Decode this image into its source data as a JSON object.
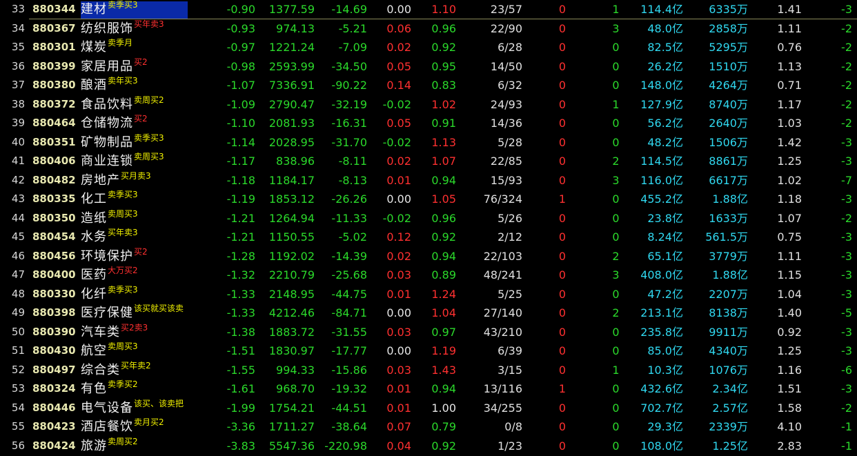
{
  "colors": {
    "background": "#000000",
    "up": "#ff3030",
    "down": "#2bd92b",
    "flat": "#e6e6e6",
    "volume": "#30d8f0",
    "tag": "#f0f000",
    "selection": "#0a2aa8"
  },
  "rows": [
    {
      "seq": "33",
      "code": "880344",
      "name": "建材",
      "tag": "卖季买3",
      "tag_color": "yellow",
      "chg": "-0.90",
      "price": "1377.59",
      "amt": "-14.69",
      "spd": "0.00",
      "spd_color": "white",
      "ratio": "1.10",
      "ratio_color": "red",
      "ud": "23/57",
      "lim": "0",
      "lim_color": "red",
      "cnt": "1",
      "cnt_color": "green",
      "vol": "114.4亿",
      "vol2": "6335万",
      "mult": "1.41",
      "last": "-3",
      "selected": true
    },
    {
      "seq": "34",
      "code": "880367",
      "name": "纺织服饰",
      "tag": "买年卖3",
      "tag_color": "red",
      "chg": "-0.93",
      "price": "974.13",
      "amt": "-5.21",
      "spd": "0.06",
      "spd_color": "red",
      "ratio": "0.96",
      "ratio_color": "green",
      "ud": "22/90",
      "lim": "0",
      "lim_color": "red",
      "cnt": "3",
      "cnt_color": "green",
      "vol": "48.0亿",
      "vol2": "2858万",
      "mult": "1.11",
      "last": "-2"
    },
    {
      "seq": "35",
      "code": "880301",
      "name": "煤炭",
      "tag": "卖季月",
      "tag_color": "yellow",
      "chg": "-0.97",
      "price": "1221.24",
      "amt": "-7.09",
      "spd": "0.02",
      "spd_color": "red",
      "ratio": "0.92",
      "ratio_color": "green",
      "ud": "6/28",
      "lim": "0",
      "lim_color": "red",
      "cnt": "0",
      "cnt_color": "green",
      "vol": "82.5亿",
      "vol2": "5295万",
      "mult": "0.76",
      "last": "-2"
    },
    {
      "seq": "36",
      "code": "880399",
      "name": "家居用品",
      "tag": "买2",
      "tag_color": "red",
      "chg": "-0.98",
      "price": "2593.99",
      "amt": "-34.50",
      "spd": "0.05",
      "spd_color": "red",
      "ratio": "0.95",
      "ratio_color": "green",
      "ud": "14/50",
      "lim": "0",
      "lim_color": "red",
      "cnt": "0",
      "cnt_color": "green",
      "vol": "26.2亿",
      "vol2": "1510万",
      "mult": "1.13",
      "last": "-2"
    },
    {
      "seq": "37",
      "code": "880380",
      "name": "酿酒",
      "tag": "卖年买3",
      "tag_color": "yellow",
      "chg": "-1.07",
      "price": "7336.91",
      "amt": "-90.22",
      "spd": "0.14",
      "spd_color": "red",
      "ratio": "0.83",
      "ratio_color": "green",
      "ud": "6/32",
      "lim": "0",
      "lim_color": "red",
      "cnt": "0",
      "cnt_color": "green",
      "vol": "148.0亿",
      "vol2": "4264万",
      "mult": "0.71",
      "last": "-2"
    },
    {
      "seq": "38",
      "code": "880372",
      "name": "食品饮料",
      "tag": "卖周买2",
      "tag_color": "yellow",
      "chg": "-1.09",
      "price": "2790.47",
      "amt": "-32.19",
      "spd": "-0.02",
      "spd_color": "green",
      "ratio": "1.02",
      "ratio_color": "red",
      "ud": "24/93",
      "lim": "0",
      "lim_color": "red",
      "cnt": "1",
      "cnt_color": "green",
      "vol": "127.9亿",
      "vol2": "8740万",
      "mult": "1.17",
      "last": "-2"
    },
    {
      "seq": "39",
      "code": "880464",
      "name": "仓储物流",
      "tag": "买2",
      "tag_color": "red",
      "chg": "-1.10",
      "price": "2081.93",
      "amt": "-16.31",
      "spd": "0.05",
      "spd_color": "red",
      "ratio": "0.91",
      "ratio_color": "green",
      "ud": "14/36",
      "lim": "0",
      "lim_color": "red",
      "cnt": "0",
      "cnt_color": "green",
      "vol": "56.2亿",
      "vol2": "2640万",
      "mult": "1.03",
      "last": "-2"
    },
    {
      "seq": "40",
      "code": "880351",
      "name": "矿物制品",
      "tag": "卖季买3",
      "tag_color": "yellow",
      "chg": "-1.14",
      "price": "2028.95",
      "amt": "-31.70",
      "spd": "-0.02",
      "spd_color": "green",
      "ratio": "1.13",
      "ratio_color": "red",
      "ud": "5/28",
      "lim": "0",
      "lim_color": "red",
      "cnt": "0",
      "cnt_color": "green",
      "vol": "48.2亿",
      "vol2": "1506万",
      "mult": "1.42",
      "last": "-3"
    },
    {
      "seq": "41",
      "code": "880406",
      "name": "商业连锁",
      "tag": "卖周买3",
      "tag_color": "yellow",
      "chg": "-1.17",
      "price": "838.96",
      "amt": "-8.11",
      "spd": "0.02",
      "spd_color": "red",
      "ratio": "1.07",
      "ratio_color": "red",
      "ud": "22/85",
      "lim": "0",
      "lim_color": "red",
      "cnt": "2",
      "cnt_color": "green",
      "vol": "114.5亿",
      "vol2": "8861万",
      "mult": "1.25",
      "last": "-3"
    },
    {
      "seq": "42",
      "code": "880482",
      "name": "房地产",
      "tag": "买月卖3",
      "tag_color": "yellow",
      "chg": "-1.18",
      "price": "1184.17",
      "amt": "-8.13",
      "spd": "0.01",
      "spd_color": "red",
      "ratio": "0.94",
      "ratio_color": "green",
      "ud": "15/93",
      "lim": "0",
      "lim_color": "red",
      "cnt": "3",
      "cnt_color": "green",
      "vol": "116.0亿",
      "vol2": "6617万",
      "mult": "1.02",
      "last": "-7"
    },
    {
      "seq": "43",
      "code": "880335",
      "name": "化工",
      "tag": "卖季买3",
      "tag_color": "yellow",
      "chg": "-1.19",
      "price": "1853.12",
      "amt": "-26.26",
      "spd": "0.00",
      "spd_color": "white",
      "ratio": "1.05",
      "ratio_color": "red",
      "ud": "76/324",
      "lim": "1",
      "lim_color": "red",
      "cnt": "0",
      "cnt_color": "green",
      "vol": "455.2亿",
      "vol2": "1.88亿",
      "mult": "1.18",
      "last": "-3"
    },
    {
      "seq": "44",
      "code": "880350",
      "name": "造纸",
      "tag": "卖周买3",
      "tag_color": "yellow",
      "chg": "-1.21",
      "price": "1264.94",
      "amt": "-11.33",
      "spd": "-0.02",
      "spd_color": "green",
      "ratio": "0.96",
      "ratio_color": "green",
      "ud": "5/26",
      "lim": "0",
      "lim_color": "red",
      "cnt": "0",
      "cnt_color": "green",
      "vol": "23.8亿",
      "vol2": "1633万",
      "mult": "1.07",
      "last": "-2"
    },
    {
      "seq": "45",
      "code": "880454",
      "name": "水务",
      "tag": "买年卖3",
      "tag_color": "yellow",
      "chg": "-1.21",
      "price": "1150.55",
      "amt": "-5.02",
      "spd": "0.12",
      "spd_color": "red",
      "ratio": "0.92",
      "ratio_color": "green",
      "ud": "2/12",
      "lim": "0",
      "lim_color": "red",
      "cnt": "0",
      "cnt_color": "green",
      "vol": "8.24亿",
      "vol2": "561.5万",
      "mult": "0.75",
      "last": "-3"
    },
    {
      "seq": "46",
      "code": "880456",
      "name": "环境保护",
      "tag": "买2",
      "tag_color": "red",
      "chg": "-1.28",
      "price": "1192.02",
      "amt": "-14.39",
      "spd": "0.02",
      "spd_color": "red",
      "ratio": "0.94",
      "ratio_color": "green",
      "ud": "22/103",
      "lim": "0",
      "lim_color": "red",
      "cnt": "2",
      "cnt_color": "green",
      "vol": "65.1亿",
      "vol2": "3779万",
      "mult": "1.11",
      "last": "-3"
    },
    {
      "seq": "47",
      "code": "880400",
      "name": "医药",
      "tag": "大万买2",
      "tag_color": "red",
      "chg": "-1.32",
      "price": "2210.79",
      "amt": "-25.68",
      "spd": "0.03",
      "spd_color": "red",
      "ratio": "0.89",
      "ratio_color": "green",
      "ud": "48/241",
      "lim": "0",
      "lim_color": "red",
      "cnt": "3",
      "cnt_color": "green",
      "vol": "408.0亿",
      "vol2": "1.88亿",
      "mult": "1.15",
      "last": "-3"
    },
    {
      "seq": "48",
      "code": "880330",
      "name": "化纤",
      "tag": "卖季买3",
      "tag_color": "yellow",
      "chg": "-1.33",
      "price": "2148.95",
      "amt": "-44.75",
      "spd": "0.01",
      "spd_color": "red",
      "ratio": "1.24",
      "ratio_color": "red",
      "ud": "5/25",
      "lim": "0",
      "lim_color": "red",
      "cnt": "0",
      "cnt_color": "green",
      "vol": "47.2亿",
      "vol2": "2207万",
      "mult": "1.04",
      "last": "-3"
    },
    {
      "seq": "49",
      "code": "880398",
      "name": "医疗保健",
      "tag": "该买就买该卖",
      "tag_color": "yellow",
      "chg": "-1.33",
      "price": "4212.46",
      "amt": "-84.71",
      "spd": "0.00",
      "spd_color": "white",
      "ratio": "1.04",
      "ratio_color": "red",
      "ud": "27/140",
      "lim": "0",
      "lim_color": "red",
      "cnt": "2",
      "cnt_color": "green",
      "vol": "213.1亿",
      "vol2": "8138万",
      "mult": "1.40",
      "last": "-5"
    },
    {
      "seq": "50",
      "code": "880390",
      "name": "汽车类",
      "tag": "买2卖3",
      "tag_color": "red",
      "chg": "-1.38",
      "price": "1883.72",
      "amt": "-31.55",
      "spd": "0.03",
      "spd_color": "red",
      "ratio": "0.97",
      "ratio_color": "green",
      "ud": "43/210",
      "lim": "0",
      "lim_color": "red",
      "cnt": "0",
      "cnt_color": "green",
      "vol": "235.8亿",
      "vol2": "9911万",
      "mult": "0.92",
      "last": "-3"
    },
    {
      "seq": "51",
      "code": "880430",
      "name": "航空",
      "tag": "卖周买3",
      "tag_color": "yellow",
      "chg": "-1.51",
      "price": "1830.97",
      "amt": "-17.77",
      "spd": "0.00",
      "spd_color": "white",
      "ratio": "1.19",
      "ratio_color": "red",
      "ud": "6/39",
      "lim": "0",
      "lim_color": "red",
      "cnt": "0",
      "cnt_color": "green",
      "vol": "85.0亿",
      "vol2": "4340万",
      "mult": "1.25",
      "last": "-3"
    },
    {
      "seq": "52",
      "code": "880497",
      "name": "综合类",
      "tag": "买年卖2",
      "tag_color": "yellow",
      "chg": "-1.55",
      "price": "994.33",
      "amt": "-15.86",
      "spd": "0.03",
      "spd_color": "red",
      "ratio": "1.43",
      "ratio_color": "red",
      "ud": "3/15",
      "lim": "0",
      "lim_color": "red",
      "cnt": "1",
      "cnt_color": "green",
      "vol": "10.3亿",
      "vol2": "1076万",
      "mult": "1.16",
      "last": "-6"
    },
    {
      "seq": "53",
      "code": "880324",
      "name": "有色",
      "tag": "卖季买2",
      "tag_color": "yellow",
      "chg": "-1.61",
      "price": "968.70",
      "amt": "-19.32",
      "spd": "0.01",
      "spd_color": "red",
      "ratio": "0.94",
      "ratio_color": "green",
      "ud": "13/116",
      "lim": "1",
      "lim_color": "red",
      "cnt": "0",
      "cnt_color": "green",
      "vol": "432.6亿",
      "vol2": "2.34亿",
      "mult": "1.51",
      "last": "-3"
    },
    {
      "seq": "54",
      "code": "880446",
      "name": "电气设备",
      "tag": "该买、该卖把",
      "tag_color": "yellow",
      "chg": "-1.99",
      "price": "1754.21",
      "amt": "-44.51",
      "spd": "0.01",
      "spd_color": "red",
      "ratio": "1.00",
      "ratio_color": "white",
      "ud": "34/255",
      "lim": "0",
      "lim_color": "red",
      "cnt": "0",
      "cnt_color": "green",
      "vol": "702.7亿",
      "vol2": "2.57亿",
      "mult": "1.58",
      "last": "-2"
    },
    {
      "seq": "55",
      "code": "880423",
      "name": "酒店餐饮",
      "tag": "卖月买2",
      "tag_color": "yellow",
      "chg": "-3.36",
      "price": "1711.27",
      "amt": "-38.64",
      "spd": "0.07",
      "spd_color": "red",
      "ratio": "0.79",
      "ratio_color": "green",
      "ud": "0/8",
      "lim": "0",
      "lim_color": "red",
      "cnt": "0",
      "cnt_color": "green",
      "vol": "29.3亿",
      "vol2": "2339万",
      "mult": "4.10",
      "last": "-1"
    },
    {
      "seq": "56",
      "code": "880424",
      "name": "旅游",
      "tag": "卖周买2",
      "tag_color": "yellow",
      "chg": "-3.83",
      "price": "5547.36",
      "amt": "-220.98",
      "spd": "0.04",
      "spd_color": "red",
      "ratio": "0.92",
      "ratio_color": "green",
      "ud": "1/23",
      "lim": "0",
      "lim_color": "red",
      "cnt": "0",
      "cnt_color": "green",
      "vol": "108.0亿",
      "vol2": "1.25亿",
      "mult": "2.83",
      "last": "-1"
    }
  ]
}
